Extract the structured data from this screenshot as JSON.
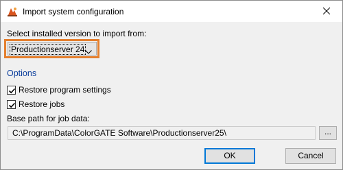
{
  "window": {
    "title": "Import system configuration",
    "close_glyph": "×"
  },
  "version_select": {
    "label": "Select installed version to import from:",
    "selected": "Productionserver 24",
    "highlight_color": "#e47f2e"
  },
  "options": {
    "section_title": "Options",
    "restore_program_settings": {
      "label": "Restore program settings",
      "checked": true
    },
    "restore_jobs": {
      "label": "Restore jobs",
      "checked": true
    }
  },
  "job_data": {
    "label": "Base path for job data:",
    "path": "C:\\ProgramData\\ColorGATE Software\\Productionserver25\\",
    "browse_label": "..."
  },
  "buttons": {
    "ok": "OK",
    "cancel": "Cancel"
  },
  "colors": {
    "accent": "#0078d7",
    "section_title": "#0a3d9c",
    "app_icon": "#d9541e"
  }
}
